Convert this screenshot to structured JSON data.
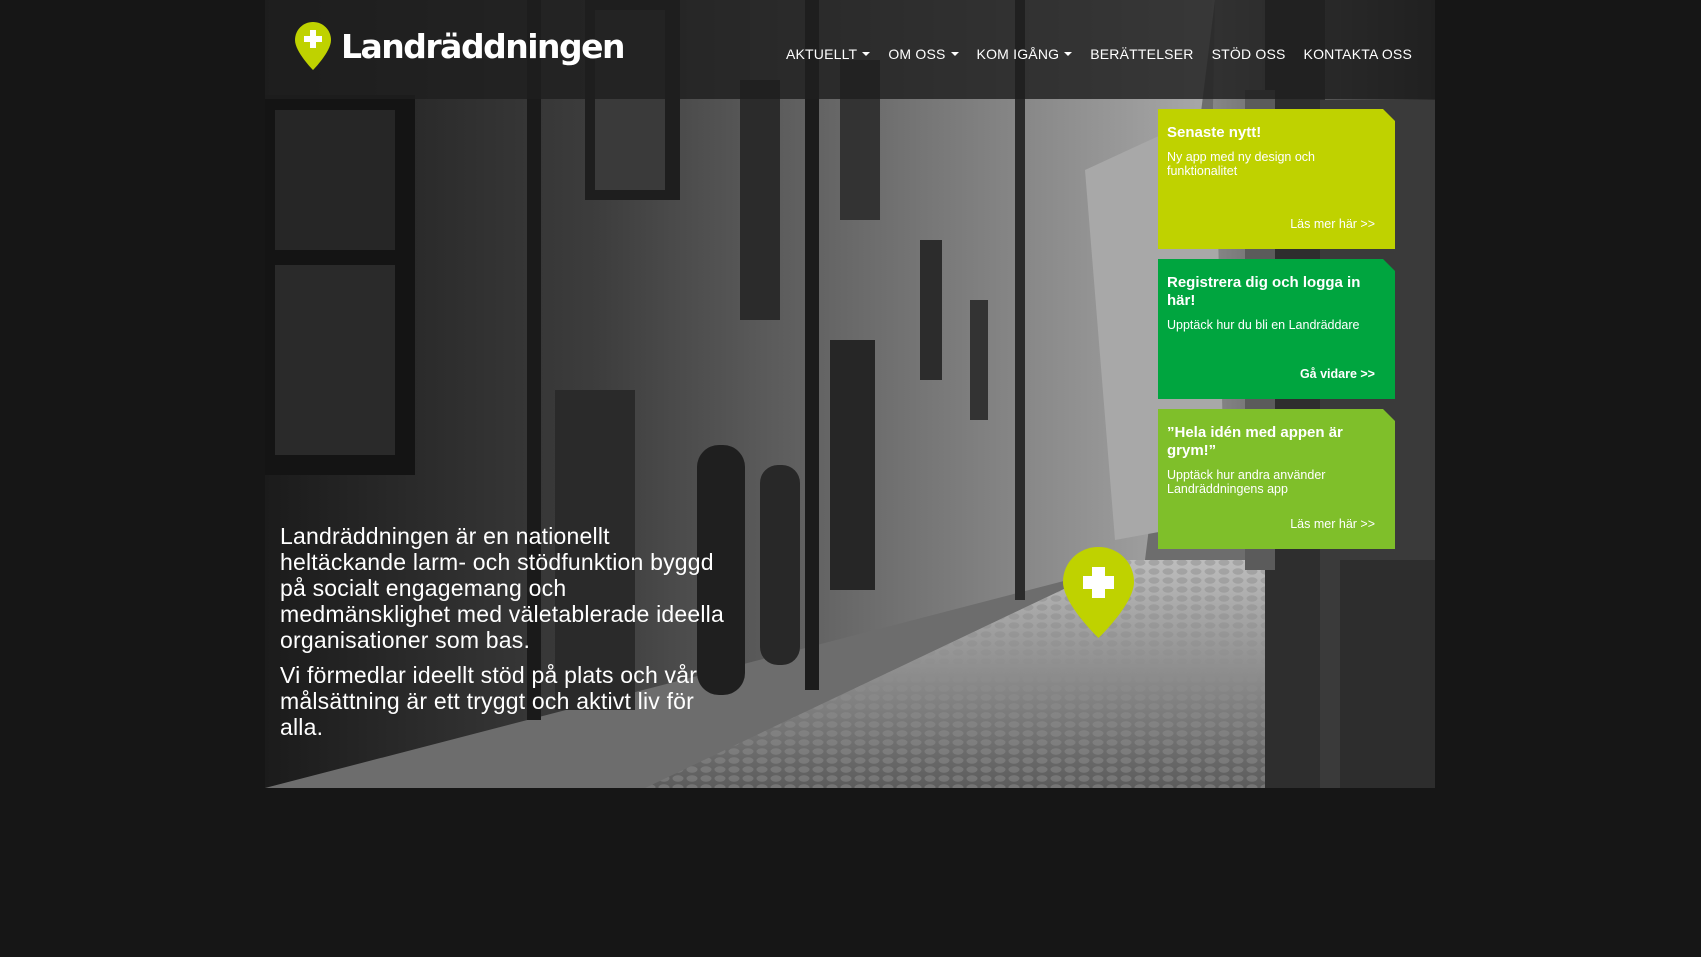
{
  "brand": {
    "name": "Landräddningen",
    "color_lime": "#bfd200",
    "color_green": "#00a53f",
    "color_green2": "#7fbf2a"
  },
  "nav": {
    "items": [
      {
        "label": "AKTUELLT",
        "dropdown": true
      },
      {
        "label": "OM OSS",
        "dropdown": true
      },
      {
        "label": "KOM IGÅNG",
        "dropdown": true
      },
      {
        "label": "BERÄTTELSER",
        "dropdown": false
      },
      {
        "label": "STÖD OSS",
        "dropdown": false
      },
      {
        "label": "KONTAKTA OSS",
        "dropdown": false
      }
    ]
  },
  "intro": {
    "paragraph1": "Landräddningen är en nationellt heltäckande larm- och stödfunktion byggd på socialt engagemang och medmänsklighet med väletablerade ideella organisationer som bas.",
    "paragraph2": "Vi förmedlar ideellt stöd på plats och vår målsättning är ett tryggt och aktivt liv för alla."
  },
  "cards": [
    {
      "title": "Senaste nytt!",
      "description": "Ny app med ny design och funktionalitet",
      "link": "Läs mer här >>",
      "color": "#bfd200"
    },
    {
      "title": "Registrera dig och logga in här!",
      "description": "Upptäck hur du bli en Landräddare",
      "link": "Gå vidare >>",
      "color": "#00a53f"
    },
    {
      "title": "”Hela idén med appen är grym!”",
      "description": "Upptäck hur andra använder Landräddningens app",
      "link": "Läs mer här >>",
      "color": "#7fbf2a"
    }
  ],
  "icons": {
    "logo": "location-pin-plus-icon",
    "center": "location-pin-plus-icon",
    "dropdown": "caret-down-icon"
  }
}
